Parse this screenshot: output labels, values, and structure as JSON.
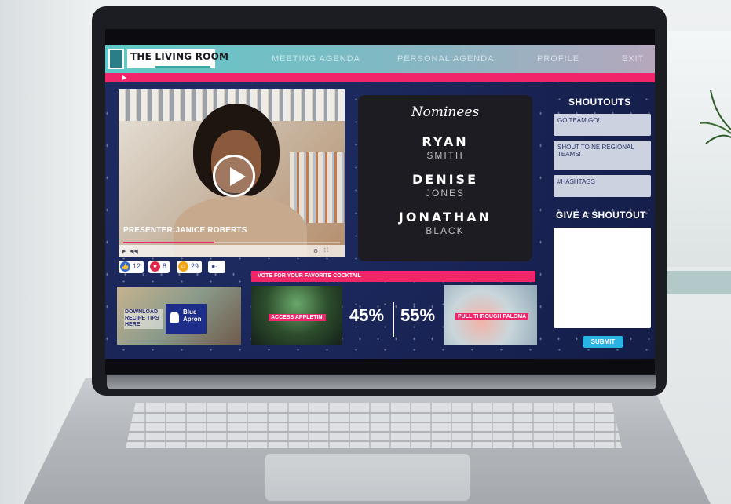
{
  "app": {
    "logo_title": "THE LIVING ROOM",
    "nav": [
      "MEETING AGENDA",
      "PERSONAL AGENDA",
      "PROFILE",
      "EXIT"
    ]
  },
  "video": {
    "presenter_label": "PRESENTER:JANICE ROBERTS",
    "progress": 0.42
  },
  "reactions": [
    {
      "icon": "thumbs-up-icon",
      "count": "12",
      "color": "#2e6ad9"
    },
    {
      "icon": "heart-icon",
      "count": "8",
      "color": "#e0264a"
    },
    {
      "icon": "laugh-icon",
      "count": "29",
      "color": "#f2a416"
    }
  ],
  "nominees": {
    "title": "Nominees",
    "people": [
      {
        "first": "RYAN",
        "last": "SMITH"
      },
      {
        "first": "DENISE",
        "last": "JONES"
      },
      {
        "first": "JONATHAN",
        "last": "BLACK"
      }
    ]
  },
  "shoutouts": {
    "title": "SHOUTOUTS",
    "items": [
      {
        "text": "GO TEAM GO!"
      },
      {
        "text": "SHOUT TO NE REGIONAL TEAMS!"
      },
      {
        "text": "#HASHTAGS"
      }
    ]
  },
  "give_shoutout": {
    "title": "GIVE A SHOUTOUT",
    "submit_label": "SUBMIT"
  },
  "ad": {
    "text": "DOWNLOAD RECIPE TIPS HERE",
    "brand": "Blue Apron"
  },
  "vote": {
    "banner": "VOTE FOR YOUR FAVORITE COCKTAIL",
    "left_label": "ACCESS APPLETINI",
    "right_label": "PULL THROUGH PALOMA",
    "left_pct": "45%",
    "right_pct": "55%"
  },
  "colors": {
    "accent_pink": "#f1266a",
    "navy": "#192455",
    "teal": "#5fc9c8",
    "submit_blue": "#2ab4e4"
  }
}
